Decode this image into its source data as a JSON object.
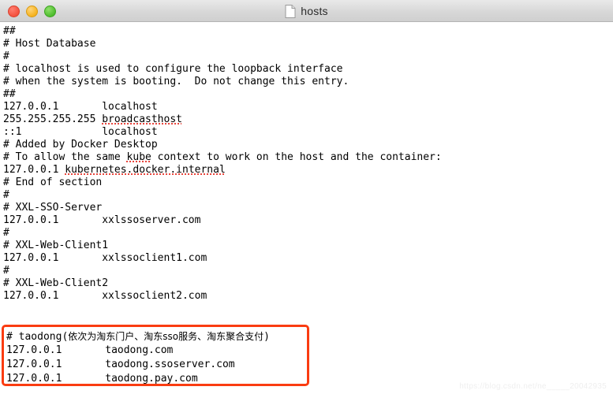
{
  "window": {
    "title": "hosts",
    "doc_icon": "document-icon",
    "controls": [
      {
        "name": "close",
        "label": "Close",
        "color": "#f4523f"
      },
      {
        "name": "minimize",
        "label": "Minimize",
        "color": "#f5b320"
      },
      {
        "name": "zoom",
        "label": "Zoom",
        "color": "#4fbd2e"
      }
    ]
  },
  "accent": {
    "highlight_border": "#fa3c11",
    "spellcheck_underline": "#e8453c",
    "titlebar_top": "#e9e9e9",
    "titlebar_bottom": "#cfcfcf"
  },
  "document": {
    "lines": [
      "##",
      "# Host Database",
      "#",
      "# localhost is used to configure the loopback interface",
      "# when the system is booting.  Do not change this entry.",
      "##",
      "127.0.0.1       localhost",
      "255.255.255.255 broadcasthost",
      "::1             localhost",
      "# Added by Docker Desktop",
      "# To allow the same kube context to work on the host and the container:",
      "127.0.0.1 kubernetes.docker.internal",
      "# End of section",
      "#",
      "# XXL-SSO-Server",
      "127.0.0.1       xxlssoserver.com",
      "#",
      "# XXL-Web-Client1",
      "127.0.0.1       xxlssoclient1.com",
      "#",
      "# XXL-Web-Client2",
      "127.0.0.1       xxlssoclient2.com",
      ""
    ]
  },
  "highlighted_block": {
    "comment_prefix": "# taodong(",
    "comment_cjk": "依次为淘东门户、淘东sso服务、淘东聚合支付",
    "comment_suffix": ")",
    "entries": [
      {
        "ip": "127.0.0.1",
        "gap": "       ",
        "host": "taodong.com"
      },
      {
        "ip": "127.0.0.1",
        "gap": "       ",
        "host": "taodong.ssoserver.com"
      },
      {
        "ip": "127.0.0.1",
        "gap": "       ",
        "host": "taodong.pay.com"
      }
    ]
  },
  "spellcheck_words": [
    "broadcasthost",
    "kube",
    "kubernetes.docker.internal"
  ],
  "watermark": "https://blog.csdn.net/ne_____20042935"
}
